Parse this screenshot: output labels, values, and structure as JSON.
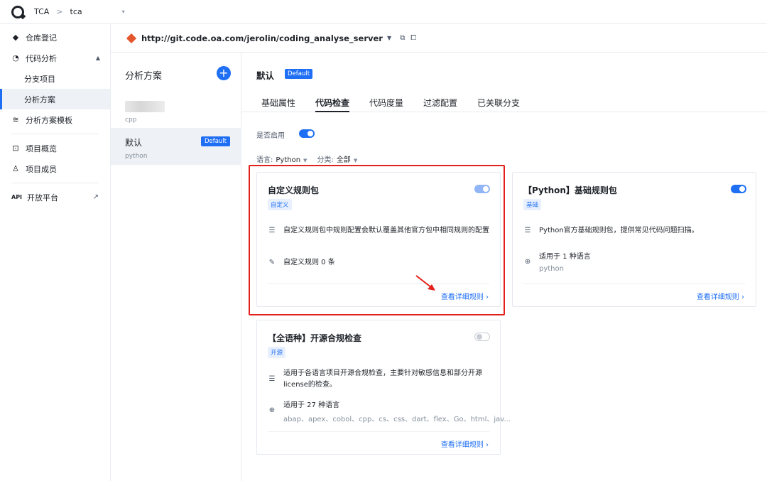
{
  "topbar": {
    "org": "TCA",
    "separator": ">",
    "project": "tca",
    "caret": "▾"
  },
  "nav": {
    "repo_register": "仓库登记",
    "code_analysis": "代码分析",
    "branch_project": "分支项目",
    "analysis_scheme": "分析方案",
    "scheme_template": "分析方案模板",
    "project_overview": "项目概览",
    "project_members": "项目成员",
    "api_tag": "API",
    "open_platform": "开放平台"
  },
  "repo": {
    "url": "http://git.code.oa.com/jerolin/coding_analyse_server"
  },
  "schemes": {
    "title": "分析方案",
    "add": "+",
    "items": [
      {
        "name": "",
        "lang": "cpp"
      },
      {
        "name": "默认",
        "lang": "python",
        "badge": "Default"
      }
    ]
  },
  "main": {
    "title": "默认",
    "badge": "Default",
    "tabs": [
      "基础属性",
      "代码检查",
      "代码度量",
      "过滤配置",
      "已关联分支"
    ],
    "active_tab": "代码检查",
    "enable_label": "是否启用",
    "lang_label": "语言:",
    "lang_value": "Python",
    "category_label": "分类:",
    "category_value": "全部"
  },
  "cards": [
    {
      "title": "自定义规则包",
      "tag": "自定义",
      "desc": "自定义规则包中规则配置会默认覆盖其他官方包中相同规则的配置",
      "row2": "自定义规则 0 条",
      "link": "查看详细规则 ›",
      "enabled": true
    },
    {
      "title": "【Python】基础规则包",
      "tag": "基础",
      "desc": "Python官方基础规则包，提供常见代码问题扫描。",
      "row2": "适用于 1 种语言",
      "row2_sub": "python",
      "link": "查看详细规则 ›",
      "enabled": true
    },
    {
      "title": "【全语种】开源合规检查",
      "tag": "开源",
      "desc_line1": "适用于各语言项目开源合规检查，主要针对敏感信息和部分开源",
      "desc_line2": "license的检查。",
      "row2": "适用于 27 种语言",
      "row2_sub": "abap、apex、cobol、cpp、cs、css、dart、flex、Go、html、jav...",
      "link": "查看详细规则 ›",
      "enabled": false
    }
  ],
  "colors": {
    "accent": "#1f6ff5",
    "highlight": "#e3201b"
  }
}
